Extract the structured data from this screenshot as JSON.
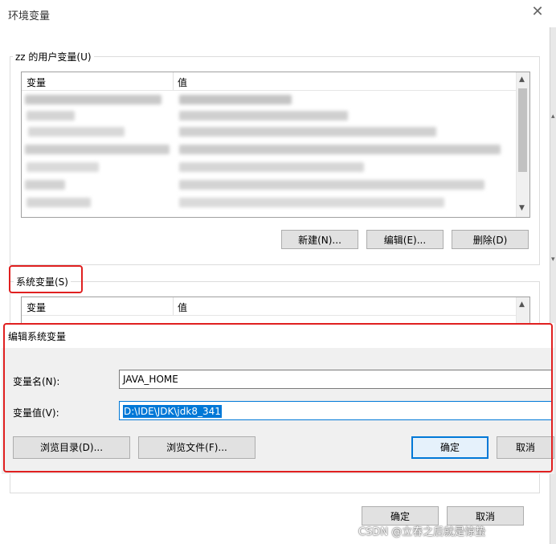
{
  "window": {
    "title": "环境变量",
    "close_glyph": "✕"
  },
  "user_vars": {
    "group_label": "zz 的用户变量(U)",
    "col_variable": "变量",
    "col_value": "值",
    "buttons": {
      "new": "新建(N)...",
      "edit": "编辑(E)...",
      "delete": "删除(D)"
    }
  },
  "system_vars": {
    "group_label": "系统变量(S)",
    "col_variable": "变量",
    "col_value": "值"
  },
  "edit_dialog": {
    "title": "编辑系统变量",
    "name_label": "变量名(N):",
    "value_label": "变量值(V):",
    "name_value": "JAVA_HOME",
    "value_value": "D:\\IDE\\JDK\\jdk8_341",
    "browse_dir": "浏览目录(D)...",
    "browse_file": "浏览文件(F)...",
    "ok": "确定",
    "cancel": "取消"
  },
  "footer": {
    "ok": "确定",
    "cancel": "取消"
  },
  "watermark": "CSDN @立春之后就是惊蛰",
  "colors": {
    "highlight": "#e02020",
    "accent": "#0078d7"
  }
}
